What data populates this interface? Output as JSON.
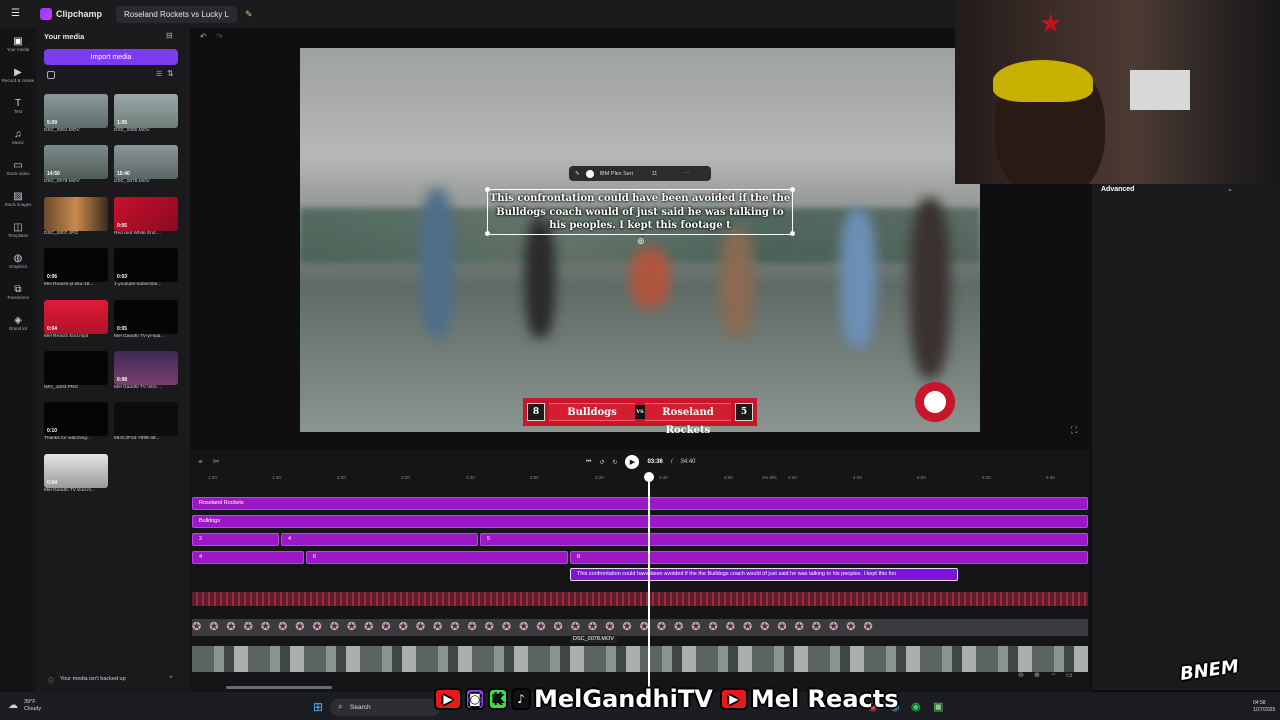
{
  "titlebar": {
    "app": "Clipchamp",
    "project": "Roseland Rockets vs Lucky L"
  },
  "rail": [
    {
      "icon": "▣",
      "label": "Your media"
    },
    {
      "icon": "▶",
      "label": "Record & create"
    },
    {
      "icon": "T",
      "label": "Text"
    },
    {
      "icon": "♫",
      "label": "Music"
    },
    {
      "icon": "▭",
      "label": "Stock video"
    },
    {
      "icon": "▨",
      "label": "Stock images"
    },
    {
      "icon": "◫",
      "label": "Templates"
    },
    {
      "icon": "◍",
      "label": "Graphics"
    },
    {
      "icon": "⧉",
      "label": "Transitions"
    },
    {
      "icon": "◈",
      "label": "Brand kit"
    }
  ],
  "media": {
    "title": "Your media",
    "import_label": "Import media",
    "backup_text": "Your media isn't backed up",
    "items": [
      {
        "name": "DSC_0081.MOV",
        "dur": "5:09"
      },
      {
        "name": "DSC_0080.MOV",
        "dur": "1:05"
      },
      {
        "name": "DSC_0079.MOV",
        "dur": "14:50"
      },
      {
        "name": "DSC_0078.MOV",
        "dur": "15:40"
      },
      {
        "name": "DSC_0007.JPG",
        "dur": ""
      },
      {
        "name": "Red and White End ...",
        "dur": "0:05"
      },
      {
        "name": "Mel Reacts-yt-sku-18...",
        "dur": "0:06"
      },
      {
        "name": "1-youtube-subscribe...",
        "dur": "0:03"
      },
      {
        "name": "Mel Reacts End.mp4",
        "dur": "0:04"
      },
      {
        "name": "Mel Gandhi TV-yt-sub...",
        "dur": "0:05"
      },
      {
        "name": "IMG_1003.PNG",
        "dur": ""
      },
      {
        "name": "Mel Gandhi TV Intro ...",
        "dur": "0:08"
      },
      {
        "name": "Thanks for watching...",
        "dur": "0:10"
      },
      {
        "name": "594C2F24-7998-48...",
        "dur": ""
      },
      {
        "name": "Mel Gandhi TV End.m...",
        "dur": "0:04"
      }
    ]
  },
  "preview": {
    "caption": "This confrontation could have been avoided if the the Bulldogs coach would of just said he was talking to his peoples. I kept this footage t",
    "font_name": "IBM Plex Seri",
    "font_size": "11",
    "score": {
      "left_num": "8",
      "left_team": "Bulldogs",
      "vs": "VS",
      "right_team": "Roseland Rockets",
      "right_num": "5"
    }
  },
  "right_panel": {
    "advanced": "Advanced"
  },
  "timeline": {
    "time_current": "03:36",
    "time_total": "34:40",
    "ruler": [
      "1:20",
      "1:40",
      "2:00",
      "2:20",
      "2:40",
      "3:00",
      "3:20",
      "3:40",
      "4:00",
      "2m 00s",
      "4:20",
      "4:40",
      "5:00",
      "5:20",
      "5:40"
    ],
    "tracks": {
      "t1": "Roseland Rockets",
      "t2": "Bulldogs",
      "t3a": "2",
      "t3b": "4",
      "t3c": "5",
      "t4a": "4",
      "t4b": "6",
      "t4c": "8",
      "caption_clip": "This confrontation could have been avoided if the the Bulldogs coach would of just said he was talking to his peoples. I kept this foo",
      "video_clip": "DSC_0078.MOV"
    }
  },
  "taskbar": {
    "weather_temp": "39°F",
    "weather_desc": "Cloudy",
    "search": "Search",
    "time": "04:58",
    "date": "1/27/2025"
  },
  "overlay": {
    "channel1": "MelGandhiTV",
    "channel2": "Mel Reacts",
    "watermark": "BNEM"
  }
}
